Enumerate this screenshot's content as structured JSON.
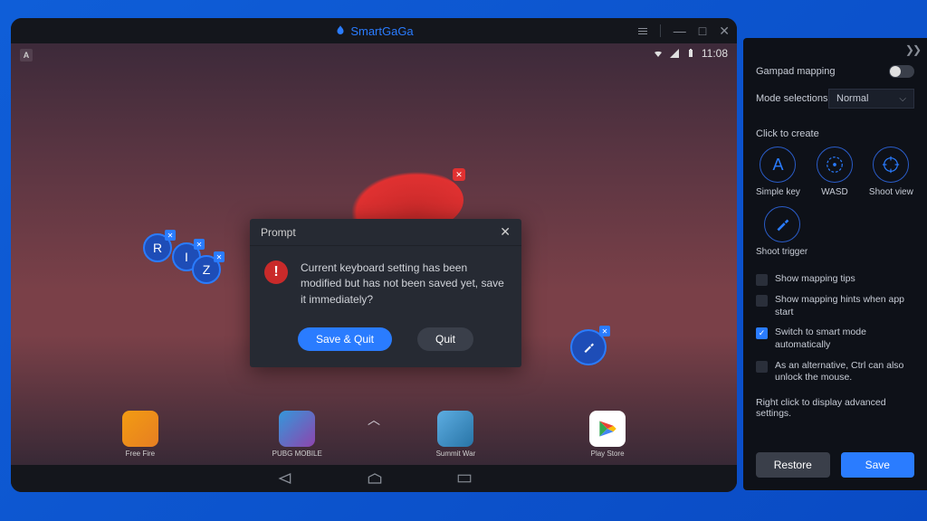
{
  "titlebar": {
    "app_name": "SmartGaGa"
  },
  "status": {
    "time": "11:08"
  },
  "keys": {
    "r": "R",
    "i": "I",
    "z": "Z"
  },
  "dock": {
    "items": [
      {
        "label": "Free Fire"
      },
      {
        "label": "PUBG MOBILE"
      },
      {
        "label": "Summit War"
      },
      {
        "label": "Play Store"
      }
    ]
  },
  "dialog": {
    "title": "Prompt",
    "message": "Current keyboard setting has been modified but has not been saved yet, save it immediately?",
    "save_quit": "Save & Quit",
    "quit": "Quit"
  },
  "panel": {
    "gamepad_label": "Gampad mapping",
    "mode_label": "Mode selections",
    "mode_value": "Normal",
    "click_create": "Click to create",
    "simple_key": "Simple key",
    "wasd": "WASD",
    "shoot_view": "Shoot view",
    "shoot_trigger": "Shoot trigger",
    "checks": {
      "tips": "Show mapping tips",
      "hints": "Show mapping hints when app start",
      "smart": "Switch to smart mode automatically",
      "ctrl": "As an alternative, Ctrl can also unlock the mouse."
    },
    "hint": "Right click to display advanced settings.",
    "restore": "Restore",
    "save": "Save"
  }
}
